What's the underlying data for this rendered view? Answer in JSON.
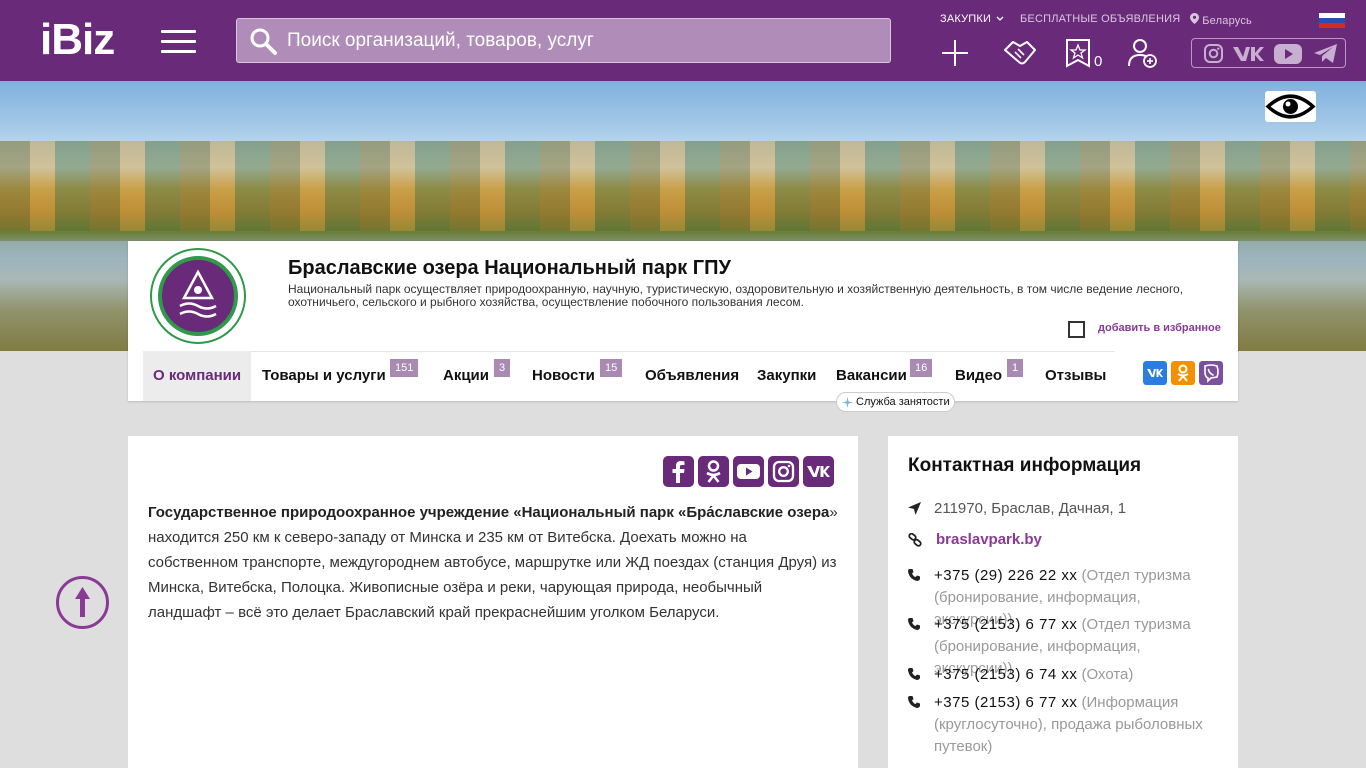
{
  "header": {
    "logo": "iBiz",
    "search_placeholder": "Поиск организаций, товаров, услуг",
    "purchases_link": "ЗАКУПКИ",
    "free_ads_link": "БЕСПЛАТНЫЕ ОБЪЯВЛЕНИЯ",
    "region": "Беларусь",
    "favorites_count": "0",
    "accent_color": "#6a2a7a"
  },
  "company": {
    "name": "Браславские озера Национальный парк ГПУ",
    "description": "Национальный парк осуществляет природоохранную, научную, туристическую, оздоровительную и хозяйственную деятельность, в том числе ведение лесного, охотничьего, сельского и рыбного хозяйства, осуществление побочного пользования лесом.",
    "add_favorite": "добавить в избранное",
    "tabs": [
      {
        "label": "О компании"
      },
      {
        "label": "Товары и услуги",
        "badge": "151"
      },
      {
        "label": "Акции",
        "badge": "3"
      },
      {
        "label": "Новости",
        "badge": "15"
      },
      {
        "label": "Объявления"
      },
      {
        "label": "Закупки"
      },
      {
        "label": "Вакансии",
        "badge": "16"
      },
      {
        "label": "Видео",
        "badge": "1"
      },
      {
        "label": "Отзывы"
      }
    ],
    "vacancy_tooltip": "Служба занятости"
  },
  "about": {
    "bold_text": "Государственное природоохранное учреждение «Национальный парк «Бра́славские озера",
    "text": "» находится 250 км к северо-западу от Минска и 235 км от Витебска. Доехать можно на собственном транспорте, междугороднем автобусе, маршрутке или ЖД поездах (станция Друя) из Минска, Витебска, Полоцка. Живописные озёра и реки, чарующая природа, необычный ландшафт – всё это делает Браславский край прекраснейшим уголком Беларуси."
  },
  "contacts": {
    "title": "Контактная информация",
    "address": "211970, Браслав, Дачная, 1",
    "website": "braslavpark.by",
    "phones": [
      {
        "number": "+375 (29) 226 22 xx",
        "note": "(Отдел туризма (бронирование, информация, экскурсии))"
      },
      {
        "number": "+375 (2153) 6 77 xx",
        "note": "(Отдел туризма (бронирование, информация, экскурсии))"
      },
      {
        "number": "+375 (2153) 6 74 xx",
        "note": "(Охота)"
      },
      {
        "number": "+375 (2153) 6 77 xx",
        "note": "(Информация (круглосуточно), продажа рыболовных путевок)"
      }
    ]
  }
}
